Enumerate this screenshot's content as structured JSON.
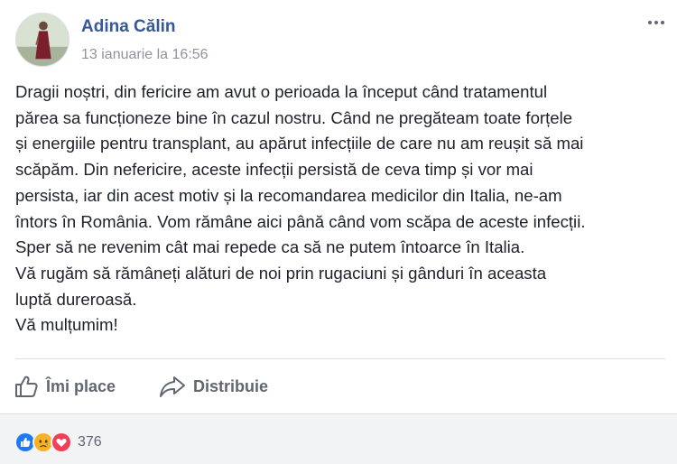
{
  "post": {
    "author": "Adina Călin",
    "timestamp": "13 ianuarie la 16:56",
    "body_lines": [
      "Dragii noștri, din fericire am avut o perioada la început când tratamentul",
      "părea sa funcționeze bine în cazul nostru. Când ne pregăteam toate forțele",
      "și energiile pentru transplant, au apărut infecțiile de care nu am reușit să mai",
      "scăpăm. Din nefericire, aceste infecții persistă de ceva timp și vor mai",
      "persista, iar din acest motiv și la recomandarea medicilor din Italia, ne-am",
      "întors în România. Vom rămâne aici până când vom scăpa de aceste infecții.",
      "Sper să ne revenim cât mai repede ca să ne putem întoarce în Italia.",
      "Vă rugăm să rămâneți alături de noi prin rugaciuni și gânduri în aceasta",
      "luptă dureroasă.",
      "Vă mulțumim!"
    ]
  },
  "actions": {
    "like_label": "Îmi place",
    "share_label": "Distribuie"
  },
  "reactions": {
    "types": [
      "like-icon",
      "sad-icon",
      "love-icon"
    ],
    "count": "376",
    "colors": {
      "like": "#2078f4",
      "sad": "#f7b125",
      "love": "#f33e58"
    }
  },
  "colors": {
    "author": "#365899",
    "meta": "#90949c",
    "text": "#1d2129",
    "action": "#606770"
  }
}
